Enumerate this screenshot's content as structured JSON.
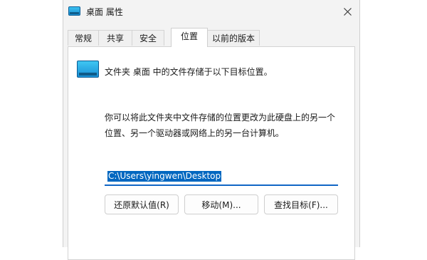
{
  "window": {
    "title": "桌面 属性",
    "close_icon": "close-icon"
  },
  "tabs": [
    {
      "label": "常规"
    },
    {
      "label": "共享"
    },
    {
      "label": "安全"
    },
    {
      "label": "位置"
    },
    {
      "label": "以前的版本"
    }
  ],
  "active_tab": "位置",
  "location": {
    "info": "文件夹 桌面 中的文件存储于以下目标位置。",
    "description_line1": "你可以将此文件夹中文件存储的位置更改为此硬盘上的另一个",
    "description_line2": "位置、另一个驱动器或网络上的另一台计算机。",
    "path": "C:\\Users\\yingwen\\Desktop"
  },
  "buttons": {
    "restore_default": "还原默认值(R)",
    "move": "移动(M)...",
    "find_target": "查找目标(F)..."
  },
  "colors": {
    "selection": "#0067c0",
    "input_underline": "#1166c6",
    "folder": "#1d8fd2"
  }
}
